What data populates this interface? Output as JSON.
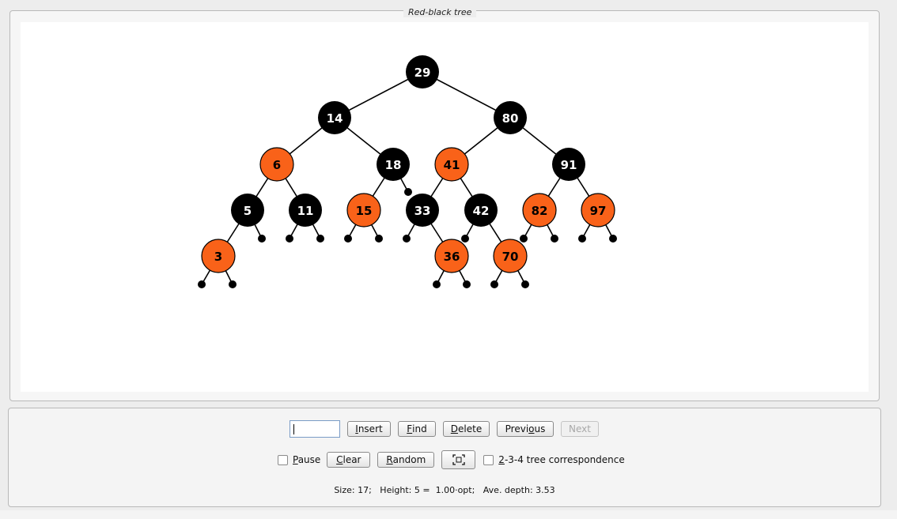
{
  "panel_title": "Red-black tree",
  "tree": {
    "colors": {
      "red": "#f96219",
      "black": "#000000"
    },
    "nodes": [
      {
        "key": "29",
        "color": "black"
      },
      {
        "key": "14",
        "color": "black"
      },
      {
        "key": "80",
        "color": "black"
      },
      {
        "key": "6",
        "color": "red"
      },
      {
        "key": "18",
        "color": "black"
      },
      {
        "key": "41",
        "color": "red"
      },
      {
        "key": "91",
        "color": "black"
      },
      {
        "key": "5",
        "color": "black"
      },
      {
        "key": "11",
        "color": "black"
      },
      {
        "key": "15",
        "color": "red"
      },
      {
        "key": "33",
        "color": "black"
      },
      {
        "key": "42",
        "color": "black"
      },
      {
        "key": "82",
        "color": "red"
      },
      {
        "key": "97",
        "color": "red"
      },
      {
        "key": "3",
        "color": "red"
      },
      {
        "key": "36",
        "color": "red"
      },
      {
        "key": "70",
        "color": "red"
      }
    ]
  },
  "controls": {
    "input_value": "",
    "insert": {
      "pre": "",
      "mn": "I",
      "post": "nsert"
    },
    "find": {
      "pre": "",
      "mn": "F",
      "post": "ind"
    },
    "delete": {
      "pre": "",
      "mn": "D",
      "post": "elete"
    },
    "previous": {
      "pre": "Previ",
      "mn": "o",
      "post": "us"
    },
    "next": "Next",
    "pause": {
      "pre": "",
      "mn": "P",
      "post": "ause"
    },
    "clear": {
      "pre": "",
      "mn": "C",
      "post": "lear"
    },
    "random": {
      "pre": "",
      "mn": "R",
      "post": "andom"
    },
    "fit_icon": "fit-to-screen-icon",
    "tree234": {
      "pre": "",
      "mn": "2",
      "post": "-3-4 tree correspondence"
    }
  },
  "status": "Size: 17;   Height: 5 =  1.00·opt;   Ave. depth: 3.53"
}
